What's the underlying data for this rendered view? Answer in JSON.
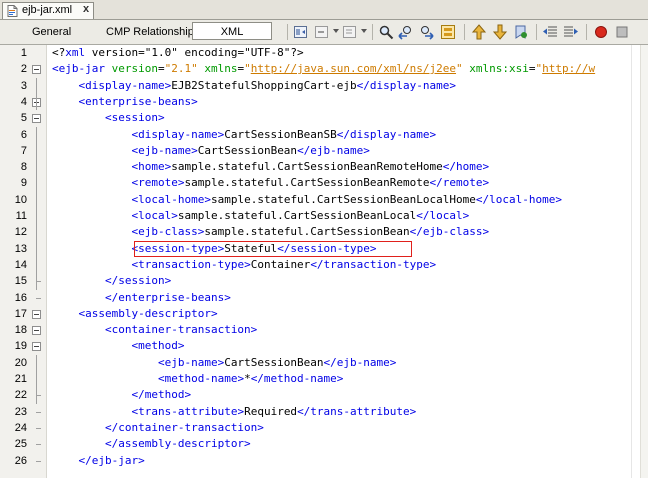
{
  "file_tab": {
    "label": "ejb-jar.xml",
    "close": "x"
  },
  "view_tabs": [
    {
      "label": "General"
    },
    {
      "label": "CMP Relationships"
    },
    {
      "label": "XML"
    }
  ],
  "toolbar_icons": [
    "back-icon",
    "forward-icon",
    "history-icon",
    "find-icon",
    "find-previous-icon",
    "find-next-icon",
    "toggle-highlight-icon",
    "previous-bookmark-icon",
    "next-bookmark-icon",
    "toggle-bookmark-icon",
    "shift-left-icon",
    "shift-right-icon",
    "start-macro-icon",
    "stop-macro-icon"
  ],
  "colors": {
    "tag": "#0000e6",
    "attribute": "#009900",
    "value": "#ce7b00",
    "highlight_border": "#e0201b"
  },
  "lines": [
    {
      "n": "1",
      "parts": [
        [
          "pi",
          "<?"
        ],
        [
          "tag",
          "xml"
        ],
        [
          "pi",
          " version=\"1.0\" encoding=\"UTF-8\"?>"
        ]
      ]
    },
    {
      "n": "2",
      "parts": [
        [
          "tag",
          "<ejb-jar"
        ],
        [
          "txt",
          " "
        ],
        [
          "attr",
          "version"
        ],
        [
          "txt",
          "="
        ],
        [
          "val",
          "\"2.1\""
        ],
        [
          "txt",
          " "
        ],
        [
          "attr",
          "xmlns"
        ],
        [
          "txt",
          "="
        ],
        [
          "val",
          "\""
        ],
        [
          "url",
          "http://java.sun.com/xml/ns/j2ee"
        ],
        [
          "val",
          "\""
        ],
        [
          "txt",
          " "
        ],
        [
          "attr",
          "xmlns:xsi"
        ],
        [
          "txt",
          "="
        ],
        [
          "val",
          "\""
        ],
        [
          "url",
          "http://w"
        ]
      ]
    },
    {
      "n": "3",
      "parts": [
        [
          "txt",
          "    "
        ],
        [
          "tag",
          "<display-name>"
        ],
        [
          "txt",
          "EJB2StatefulShoppingCart-ejb"
        ],
        [
          "tag",
          "</display-name>"
        ]
      ]
    },
    {
      "n": "4",
      "parts": [
        [
          "txt",
          "    "
        ],
        [
          "tag",
          "<enterprise-beans>"
        ]
      ]
    },
    {
      "n": "5",
      "parts": [
        [
          "txt",
          "        "
        ],
        [
          "tag",
          "<session>"
        ]
      ]
    },
    {
      "n": "6",
      "parts": [
        [
          "txt",
          "            "
        ],
        [
          "tag",
          "<display-name>"
        ],
        [
          "txt",
          "CartSessionBeanSB"
        ],
        [
          "tag",
          "</display-name>"
        ]
      ]
    },
    {
      "n": "7",
      "parts": [
        [
          "txt",
          "            "
        ],
        [
          "tag",
          "<ejb-name>"
        ],
        [
          "txt",
          "CartSessionBean"
        ],
        [
          "tag",
          "</ejb-name>"
        ]
      ]
    },
    {
      "n": "8",
      "parts": [
        [
          "txt",
          "            "
        ],
        [
          "tag",
          "<home>"
        ],
        [
          "txt",
          "sample.stateful.CartSessionBeanRemoteHome"
        ],
        [
          "tag",
          "</home>"
        ]
      ]
    },
    {
      "n": "9",
      "parts": [
        [
          "txt",
          "            "
        ],
        [
          "tag",
          "<remote>"
        ],
        [
          "txt",
          "sample.stateful.CartSessionBeanRemote"
        ],
        [
          "tag",
          "</remote>"
        ]
      ]
    },
    {
      "n": "10",
      "parts": [
        [
          "txt",
          "            "
        ],
        [
          "tag",
          "<local-home>"
        ],
        [
          "txt",
          "sample.stateful.CartSessionBeanLocalHome"
        ],
        [
          "tag",
          "</local-home>"
        ]
      ]
    },
    {
      "n": "11",
      "parts": [
        [
          "txt",
          "            "
        ],
        [
          "tag",
          "<local>"
        ],
        [
          "txt",
          "sample.stateful.CartSessionBeanLocal"
        ],
        [
          "tag",
          "</local>"
        ]
      ]
    },
    {
      "n": "12",
      "parts": [
        [
          "txt",
          "            "
        ],
        [
          "tag",
          "<ejb-class>"
        ],
        [
          "txt",
          "sample.stateful.CartSessionBean"
        ],
        [
          "tag",
          "</ejb-class>"
        ]
      ]
    },
    {
      "n": "13",
      "parts": [
        [
          "txt",
          "            "
        ],
        [
          "tag",
          "<session-type>"
        ],
        [
          "txt",
          "Stateful"
        ],
        [
          "tag",
          "</session-type>"
        ]
      ]
    },
    {
      "n": "14",
      "parts": [
        [
          "txt",
          "            "
        ],
        [
          "tag",
          "<transaction-type>"
        ],
        [
          "txt",
          "Container"
        ],
        [
          "tag",
          "</transaction-type>"
        ]
      ]
    },
    {
      "n": "15",
      "parts": [
        [
          "txt",
          "        "
        ],
        [
          "tag",
          "</session>"
        ]
      ]
    },
    {
      "n": "16",
      "parts": [
        [
          "txt",
          "        "
        ],
        [
          "tag",
          "</enterprise-beans>"
        ]
      ]
    },
    {
      "n": "17",
      "parts": [
        [
          "txt",
          "    "
        ],
        [
          "tag",
          "<assembly-descriptor>"
        ]
      ]
    },
    {
      "n": "18",
      "parts": [
        [
          "txt",
          "        "
        ],
        [
          "tag",
          "<container-transaction>"
        ]
      ]
    },
    {
      "n": "19",
      "parts": [
        [
          "txt",
          "            "
        ],
        [
          "tag",
          "<method>"
        ]
      ]
    },
    {
      "n": "20",
      "parts": [
        [
          "txt",
          "                "
        ],
        [
          "tag",
          "<ejb-name>"
        ],
        [
          "txt",
          "CartSessionBean"
        ],
        [
          "tag",
          "</ejb-name>"
        ]
      ]
    },
    {
      "n": "21",
      "parts": [
        [
          "txt",
          "                "
        ],
        [
          "tag",
          "<method-name>"
        ],
        [
          "txt",
          "*"
        ],
        [
          "tag",
          "</method-name>"
        ]
      ]
    },
    {
      "n": "22",
      "parts": [
        [
          "txt",
          "            "
        ],
        [
          "tag",
          "</method>"
        ]
      ]
    },
    {
      "n": "23",
      "parts": [
        [
          "txt",
          "            "
        ],
        [
          "tag",
          "<trans-attribute>"
        ],
        [
          "txt",
          "Required"
        ],
        [
          "tag",
          "</trans-attribute>"
        ]
      ]
    },
    {
      "n": "24",
      "parts": [
        [
          "txt",
          "        "
        ],
        [
          "tag",
          "</container-transaction>"
        ]
      ]
    },
    {
      "n": "25",
      "parts": [
        [
          "txt",
          "        "
        ],
        [
          "tag",
          "</assembly-descriptor>"
        ]
      ]
    },
    {
      "n": "26",
      "parts": [
        [
          "txt",
          "    "
        ],
        [
          "tag",
          "</ejb-jar>"
        ]
      ]
    }
  ]
}
